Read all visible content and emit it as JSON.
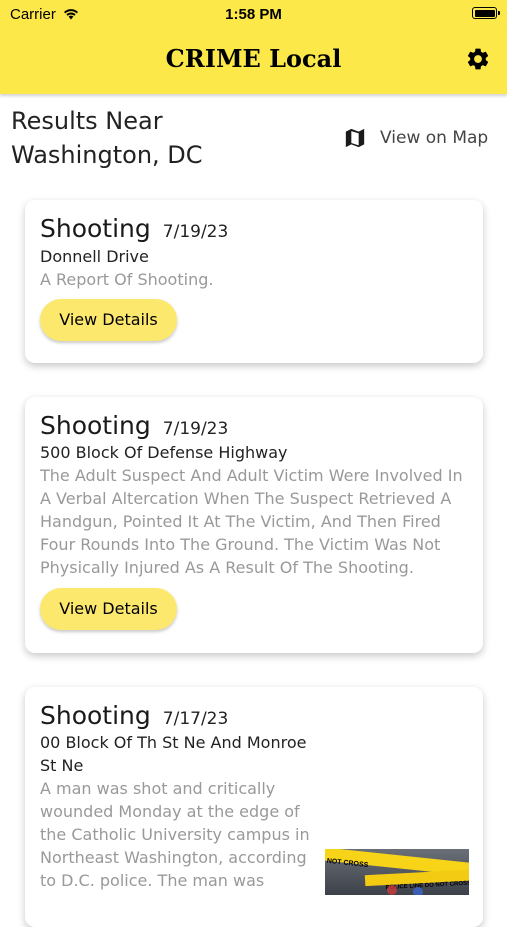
{
  "status_bar": {
    "carrier": "Carrier",
    "time": "1:58 PM"
  },
  "app_bar": {
    "title": "CRIME Local",
    "settings_icon": "gear-icon"
  },
  "header": {
    "title_line1": "Results Near",
    "title_line2": "Washington, DC",
    "map_link": "View on Map",
    "map_icon": "map-icon"
  },
  "incidents": [
    {
      "type": "Shooting",
      "date": "7/19/23",
      "location": "Donnell Drive",
      "description": "A Report Of Shooting.",
      "button": "View Details"
    },
    {
      "type": "Shooting",
      "date": "7/19/23",
      "location": "500 Block Of Defense Highway",
      "description_lines": [
        "The Adult Suspect And Adult Victim Were Involved In",
        "A Verbal Altercation When The Suspect Retrieved A",
        "Handgun, Pointed It At The Victim, And Then Fired",
        "Four Rounds Into The Ground. The Victim Was Not",
        "Physically Injured As A Result Of The Shooting."
      ],
      "button": "View Details"
    },
    {
      "type": "Shooting",
      "date": "7/17/23",
      "location_lines": [
        "00 Block Of Th St Ne And Monroe",
        "St Ne"
      ],
      "description_lines": [
        "A man was shot and critically",
        "wounded Monday at the edge of",
        "the Catholic University campus in",
        "Northeast Washington, according",
        "to D.C. police.    The man was"
      ],
      "image_texts": [
        "NOT CROSS",
        "POLICE LINE DO NOT CROSS"
      ]
    }
  ],
  "colors": {
    "accent": "#fde84a",
    "button": "#fde86e",
    "muted_text": "#999999"
  }
}
